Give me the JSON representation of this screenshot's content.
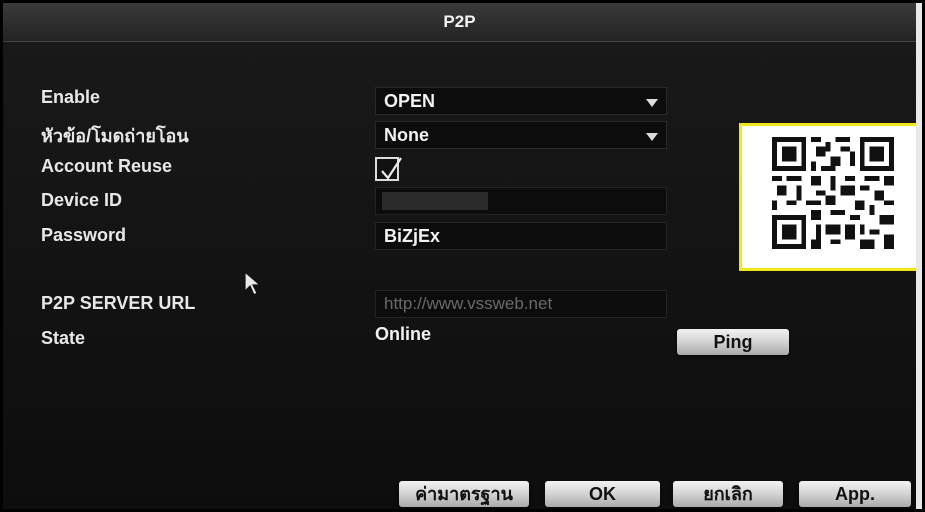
{
  "window": {
    "title": "P2P"
  },
  "form": {
    "enable": {
      "label": "Enable",
      "value": "OPEN"
    },
    "transfer_mode": {
      "label": "หัวข้อ/โมดถ่ายโอน",
      "value": "None"
    },
    "account_reuse": {
      "label": "Account Reuse",
      "checked": true
    },
    "device_id": {
      "label": "Device ID",
      "value": ""
    },
    "password": {
      "label": "Password",
      "value": "BiZjEx"
    },
    "server_url": {
      "label": "P2P SERVER URL",
      "value": "http://www.vssweb.net"
    },
    "state": {
      "label": "State",
      "value": "Online"
    }
  },
  "buttons": {
    "ping": "Ping",
    "default": "ค่ามาตรฐาน",
    "ok": "OK",
    "cancel": "ยกเลิก",
    "app": "App."
  },
  "colors": {
    "qr_highlight": "#f1e61a",
    "background": "#141414"
  },
  "icons": {
    "qr": "qr-code-icon",
    "cursor": "mouse-pointer-icon",
    "dropdown": "chevron-down-icon"
  }
}
